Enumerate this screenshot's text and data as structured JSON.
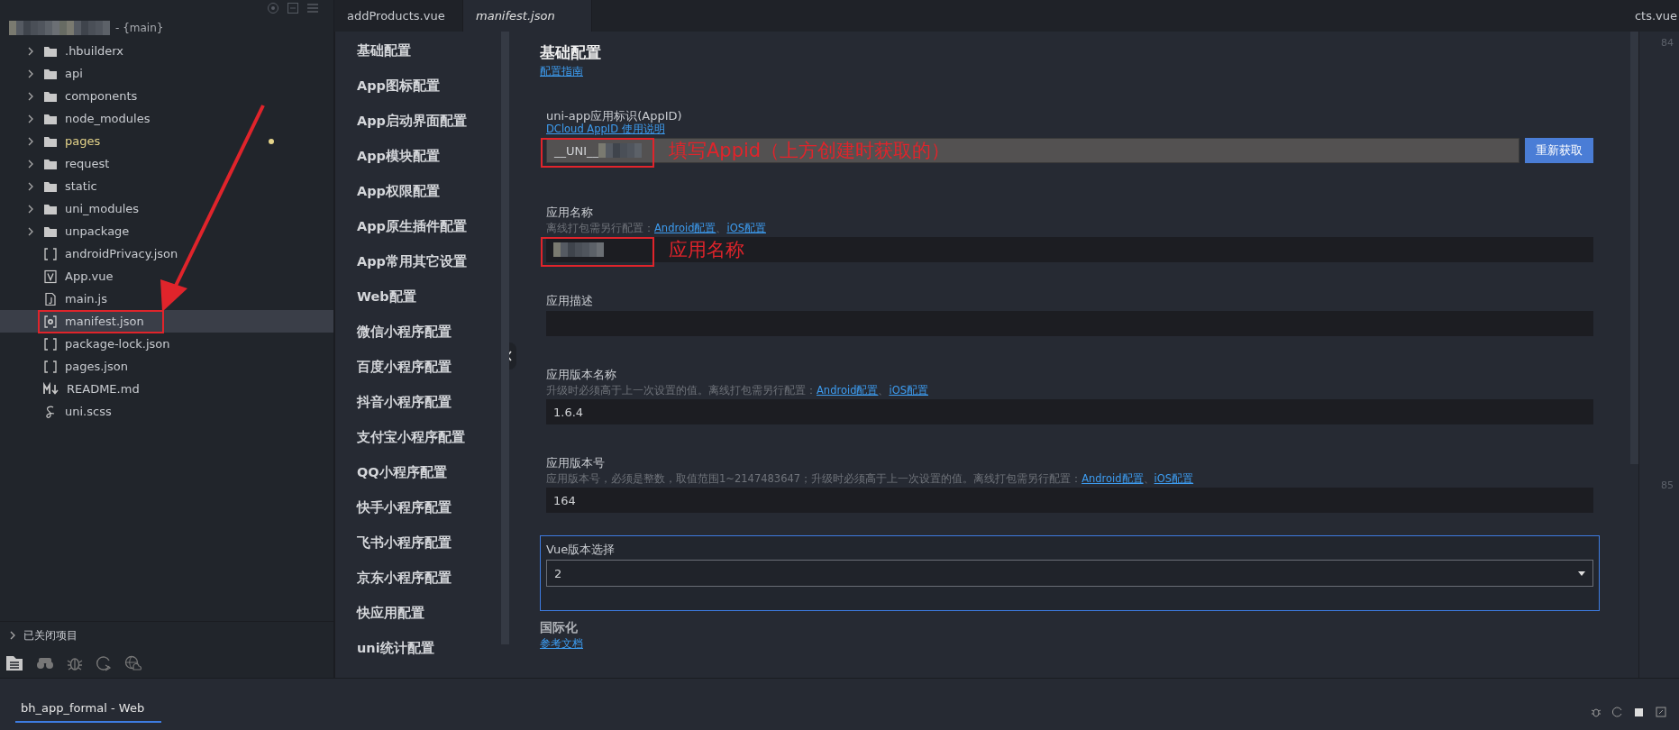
{
  "sidebar": {
    "project": {
      "name": "- {main}"
    },
    "tree": [
      {
        "label": ".hbuilderx",
        "kind": "folder",
        "modified": false,
        "selected": false,
        "annotated": false
      },
      {
        "label": "api",
        "kind": "folder",
        "modified": false,
        "selected": false,
        "annotated": false
      },
      {
        "label": "components",
        "kind": "folder",
        "modified": false,
        "selected": false,
        "annotated": false
      },
      {
        "label": "node_modules",
        "kind": "folder",
        "modified": false,
        "selected": false,
        "annotated": false
      },
      {
        "label": "pages",
        "kind": "folder",
        "modified": true,
        "selected": false,
        "annotated": false
      },
      {
        "label": "request",
        "kind": "folder",
        "modified": false,
        "selected": false,
        "annotated": false
      },
      {
        "label": "static",
        "kind": "folder",
        "modified": false,
        "selected": false,
        "annotated": false
      },
      {
        "label": "uni_modules",
        "kind": "folder",
        "modified": false,
        "selected": false,
        "annotated": false
      },
      {
        "label": "unpackage",
        "kind": "folder",
        "modified": false,
        "selected": false,
        "annotated": false
      },
      {
        "label": "androidPrivacy.json",
        "kind": "json",
        "modified": false,
        "selected": false,
        "annotated": false
      },
      {
        "label": "App.vue",
        "kind": "vue",
        "modified": false,
        "selected": false,
        "annotated": false
      },
      {
        "label": "main.js",
        "kind": "js",
        "modified": false,
        "selected": false,
        "annotated": false
      },
      {
        "label": "manifest.json",
        "kind": "manifest",
        "modified": false,
        "selected": true,
        "annotated": true
      },
      {
        "label": "package-lock.json",
        "kind": "json",
        "modified": false,
        "selected": false,
        "annotated": false
      },
      {
        "label": "pages.json",
        "kind": "json",
        "modified": false,
        "selected": false,
        "annotated": false
      },
      {
        "label": "README.md",
        "kind": "md",
        "modified": false,
        "selected": false,
        "annotated": false
      },
      {
        "label": "uni.scss",
        "kind": "scss",
        "modified": false,
        "selected": false,
        "annotated": false
      }
    ],
    "closed_projects": "已关闭项目"
  },
  "tabs": [
    {
      "label": "addProducts.vue",
      "selected": false
    },
    {
      "label": "manifest.json",
      "selected": true
    },
    {
      "label": "cts.vue",
      "selected": false
    }
  ],
  "nav": [
    "基础配置",
    "App图标配置",
    "App启动界面配置",
    "App模块配置",
    "App权限配置",
    "App原生插件配置",
    "App常用其它设置",
    "Web配置",
    "微信小程序配置",
    "百度小程序配置",
    "抖音小程序配置",
    "支付宝小程序配置",
    "QQ小程序配置",
    "快手小程序配置",
    "飞书小程序配置",
    "京东小程序配置",
    "快应用配置",
    "uni统计配置"
  ],
  "form": {
    "title": "基础配置",
    "guide_link": "配置指南",
    "fields": [
      {
        "kind": "appid",
        "label": "uni-app应用标识(AppID)",
        "hint_links": [
          "DCloud AppID 使用说明"
        ],
        "value": "__UNI__",
        "redacted": true,
        "button": "重新获取",
        "annotation": "填写Appid（上方创建时获取的）"
      },
      {
        "kind": "text",
        "label": "应用名称",
        "hint": "离线打包需另行配置：",
        "hint_links": [
          "Android配置",
          "iOS配置"
        ],
        "redacted": true,
        "annotation": "应用名称"
      },
      {
        "kind": "text",
        "label": "应用描述"
      },
      {
        "kind": "text",
        "label": "应用版本名称",
        "hint": "升级时必须高于上一次设置的值。离线打包需另行配置：",
        "hint_links": [
          "Android配置",
          "iOS配置"
        ],
        "value": "1.6.4"
      },
      {
        "kind": "text",
        "label": "应用版本号",
        "hint": "应用版本号，必须是整数，取值范围1~2147483647；升级时必须高于上一次设置的值。离线打包需另行配置：",
        "hint_links": [
          "Android配置",
          "iOS配置"
        ],
        "value": "164"
      },
      {
        "kind": "select",
        "label": "Vue版本选择",
        "value": "2",
        "focused": true
      }
    ],
    "link_separator": "、",
    "section": {
      "title": "国际化",
      "link": "参考文档"
    }
  },
  "gutter": [
    "84",
    "85"
  ],
  "status_bar": {
    "project": "bh_app_formal - Web"
  }
}
